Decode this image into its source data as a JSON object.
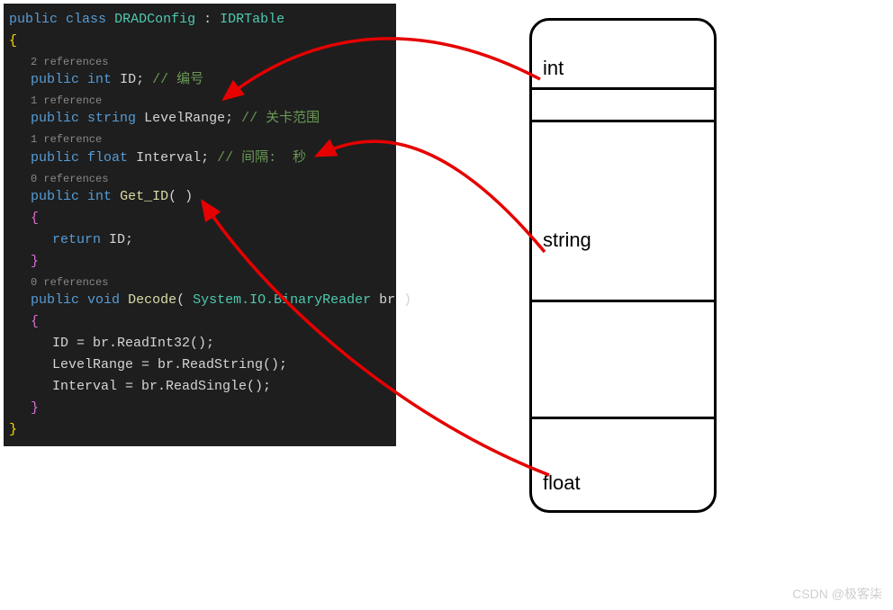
{
  "code": {
    "declaration": {
      "public": "public",
      "class": "class",
      "name": "DRADConfig",
      "colon": ":",
      "base": "IDRTable"
    },
    "refs2": "2 references",
    "refs1a": "1 reference",
    "refs1b": "1 reference",
    "refs0a": "0 references",
    "refs0b": "0 references",
    "field_id": {
      "public": "public",
      "type": "int",
      "name": "ID",
      "semi": ";",
      "comment": "// 编号"
    },
    "field_level": {
      "public": "public",
      "type": "string",
      "name": "LevelRange",
      "semi": ";",
      "comment": "// 关卡范围"
    },
    "field_interval": {
      "public": "public",
      "type": "float",
      "name": "Interval",
      "semi": ";",
      "comment": "// 间隔:  秒"
    },
    "getid": {
      "public": "public",
      "type": "int",
      "name": "Get_ID",
      "parens": "( )"
    },
    "return_stmt": {
      "kw": "return",
      "val": "ID",
      "semi": ";"
    },
    "decode": {
      "public": "public",
      "type": "void",
      "name": "Decode",
      "open": "(",
      "argtype": " System.IO.BinaryReader ",
      "argname": "br ",
      "close": ")"
    },
    "body1": "ID = br.ReadInt32();",
    "body2": "LevelRange = br.ReadString();",
    "body3": "Interval = br.ReadSingle();"
  },
  "cells": {
    "c1": "int",
    "c2": "",
    "c3": "string",
    "c4": "",
    "c5": "float"
  },
  "watermark": "CSDN @极客柒"
}
